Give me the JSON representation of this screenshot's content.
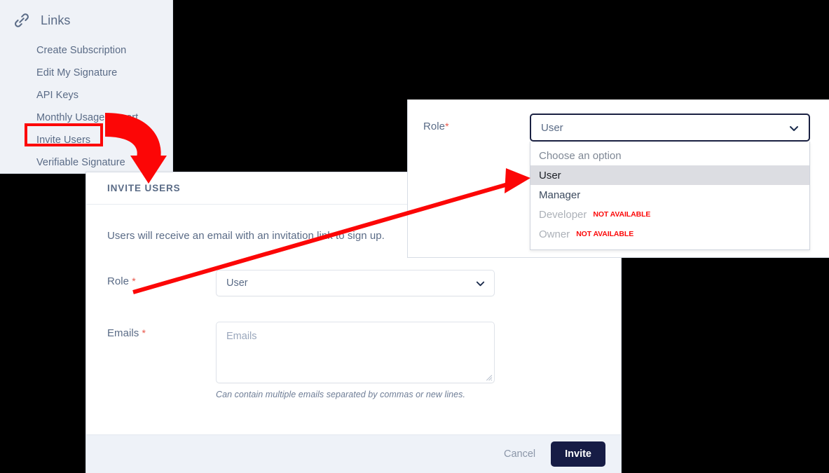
{
  "sidebar": {
    "icon": "link-chain-icon",
    "title": "Links",
    "items": [
      {
        "label": "Create Subscription"
      },
      {
        "label": "Edit My Signature"
      },
      {
        "label": "API Keys"
      },
      {
        "label": "Monthly Usage Report"
      },
      {
        "label": "Invite Users",
        "highlighted": true
      },
      {
        "label": "Verifiable Signature"
      }
    ]
  },
  "modal": {
    "heading": "INVITE USERS",
    "intro": "Users will receive an email with an invitation link to sign up.",
    "fields": {
      "role": {
        "label": "Role",
        "required_marker": "*",
        "value": "User",
        "chevron_icon": "chevron-down-icon"
      },
      "emails": {
        "label": "Emails",
        "required_marker": "*",
        "value": "",
        "placeholder": "Emails",
        "helper": "Can contain multiple emails separated by commas or new lines.",
        "resize_icon": "resize-grip-icon"
      }
    },
    "footer": {
      "cancel_label": "Cancel",
      "invite_label": "Invite"
    }
  },
  "dropdown_inset": {
    "role_label": "Role",
    "required_marker": "*",
    "selected_value": "User",
    "chevron_icon": "chevron-down-icon",
    "options": [
      {
        "label": "Choose an option",
        "state": "placeholder",
        "badge": ""
      },
      {
        "label": "User",
        "state": "selected",
        "badge": ""
      },
      {
        "label": "Manager",
        "state": "normal",
        "badge": ""
      },
      {
        "label": "Developer",
        "state": "disabled",
        "badge": "NOT AVAILABLE"
      },
      {
        "label": "Owner",
        "state": "disabled",
        "badge": "NOT AVAILABLE"
      }
    ]
  },
  "annotations": {
    "highlight_color": "#fc0606",
    "arrow_color": "#fc0606",
    "curved_arrow": "sidebar-invite-users-to-modal",
    "straight_arrow": "modal-role-to-dropdown-user-option"
  },
  "colors": {
    "sidebar_bg": "#eff2f7",
    "text_muted": "#5a6b86",
    "required_star": "#e8564a",
    "primary_button": "#161c45",
    "footer_bg": "#eef2f8",
    "focus_border": "#1a2142",
    "option_selected_bg": "#dcdde2",
    "not_available": "#fc0a0a"
  }
}
